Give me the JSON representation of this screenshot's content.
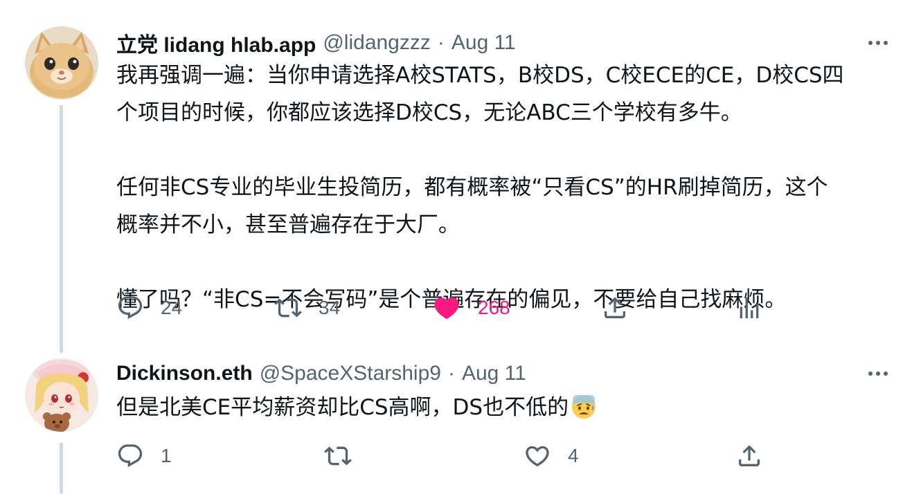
{
  "tweets": [
    {
      "display_name": "立党 lidang hlab.app",
      "handle": "@lidangzzz",
      "separator": "·",
      "date": "Aug 11",
      "text": "我再强调一遍：当你申请选择A校STATS，B校DS，C校ECE的CE，D校CS四\n个项目的时候，你都应该选择D校CS，无论ABC三个学校有多牛。\n\n任何非CS专业的毕业生投简历，都有概率被“只看CS”的HR刷掉简历，这个\n概率并不小，甚至普遍存在于大厂。\n\n懂了吗？“非CS=不会写码”是个普遍存在的偏见，不要给自己找麻烦。",
      "replies": "24",
      "retweets": "34",
      "likes": "268",
      "liked": true,
      "avatar_icon": "cat-avatar",
      "accent_colors": {
        "like": "#f91880",
        "muted": "#536471"
      }
    },
    {
      "display_name": "Dickinson.eth",
      "handle": "@SpaceXStarship9",
      "separator": "·",
      "date": "Aug 11",
      "text": "但是北美CE平均薪资却比CS高啊，DS也不低的",
      "emoji": "anxious-face-with-sweat",
      "replies": "1",
      "retweets": "",
      "likes": "4",
      "liked": false,
      "avatar_icon": "anime-girl-avatar"
    }
  ]
}
